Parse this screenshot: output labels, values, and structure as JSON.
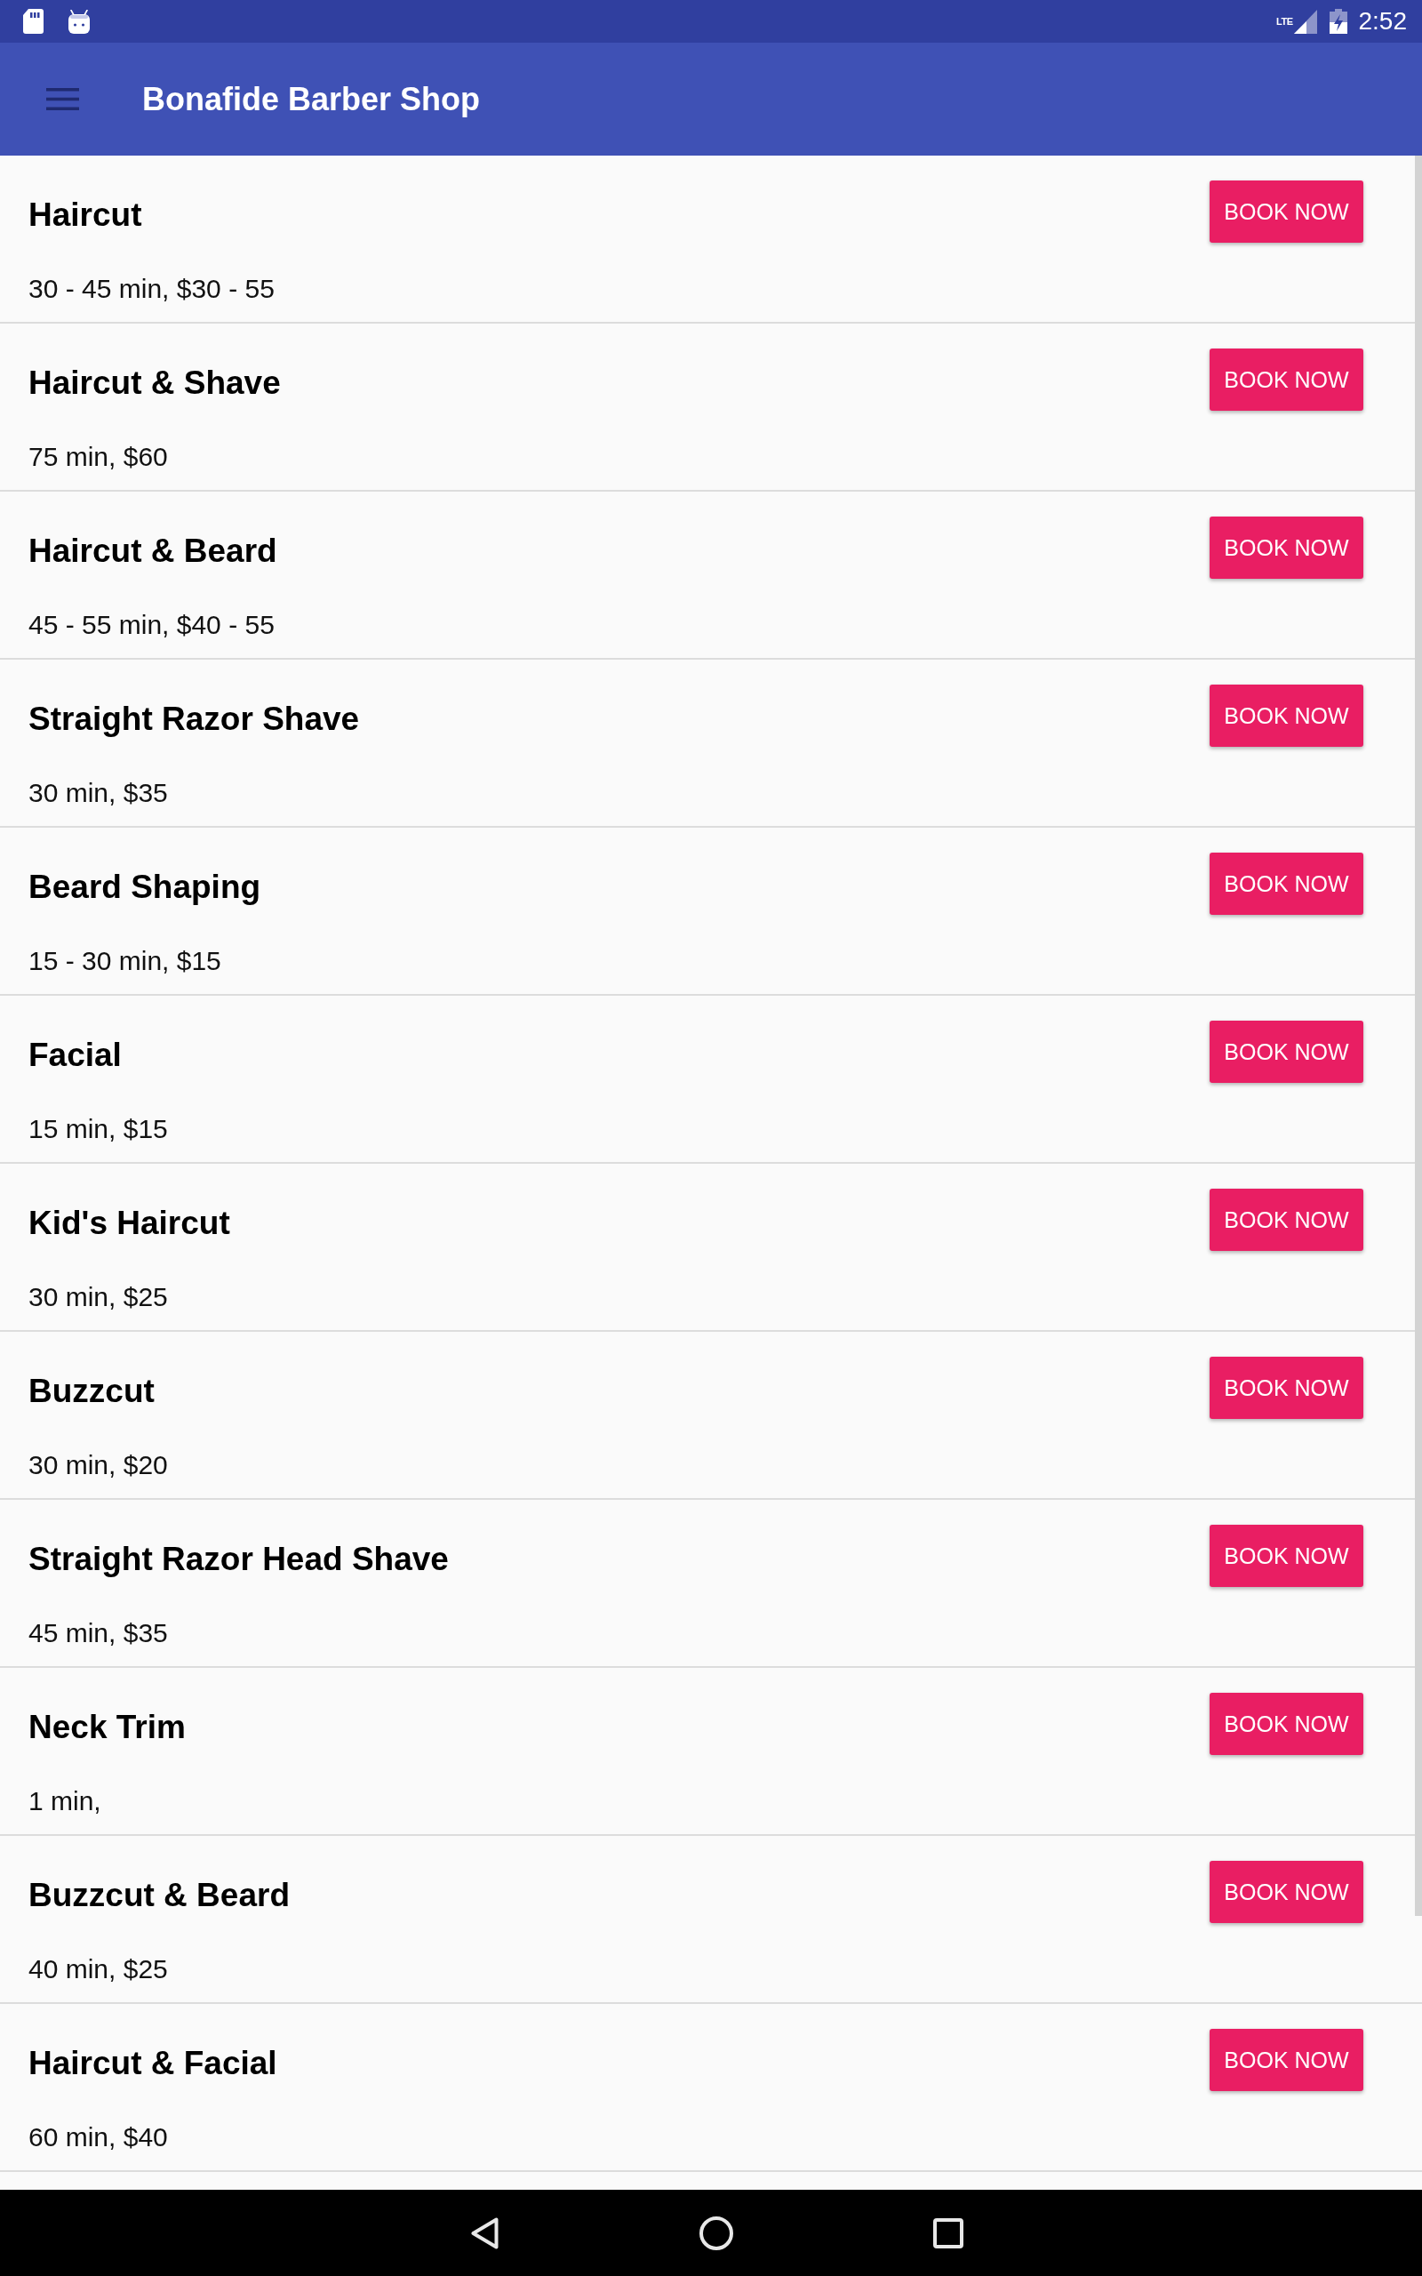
{
  "status_bar": {
    "network_type": "LTE",
    "time": "2:52"
  },
  "app_bar": {
    "title": "Bonafide Barber Shop"
  },
  "services": [
    {
      "name": "Haircut",
      "details": "30 - 45 min, $30 - 55",
      "button": "BOOK NOW"
    },
    {
      "name": "Haircut & Shave",
      "details": "75 min, $60",
      "button": "BOOK NOW"
    },
    {
      "name": "Haircut & Beard",
      "details": "45 - 55 min, $40 - 55",
      "button": "BOOK NOW"
    },
    {
      "name": "Straight Razor Shave",
      "details": "30 min, $35",
      "button": "BOOK NOW"
    },
    {
      "name": "Beard Shaping",
      "details": "15 - 30 min, $15",
      "button": "BOOK NOW"
    },
    {
      "name": "Facial",
      "details": "15 min, $15",
      "button": "BOOK NOW"
    },
    {
      "name": "Kid's Haircut",
      "details": "30 min, $25",
      "button": "BOOK NOW"
    },
    {
      "name": "Buzzcut",
      "details": "30 min, $20",
      "button": "BOOK NOW"
    },
    {
      "name": "Straight Razor Head Shave",
      "details": "45 min, $35",
      "button": "BOOK NOW"
    },
    {
      "name": "Neck Trim",
      "details": "1 min,",
      "button": "BOOK NOW"
    },
    {
      "name": "Buzzcut & Beard",
      "details": "40 min, $25",
      "button": "BOOK NOW"
    },
    {
      "name": "Haircut & Facial",
      "details": "60 min, $40",
      "button": "BOOK NOW"
    }
  ]
}
